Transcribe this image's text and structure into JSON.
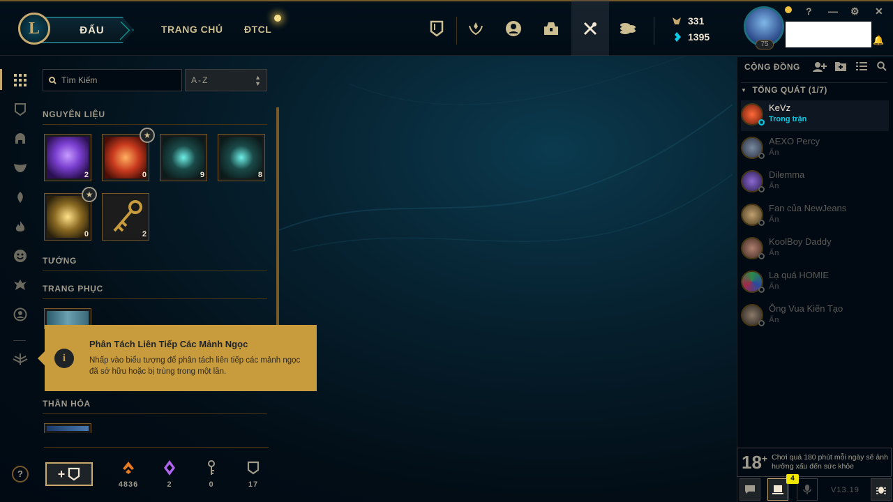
{
  "topbar": {
    "play_label": "ĐẤU",
    "nav": [
      "TRANG CHỦ",
      "ĐTCL"
    ],
    "blue_essence": "331",
    "riot_points": "1395",
    "level": "75",
    "window_controls": [
      "?",
      "—",
      "⚙",
      "✕"
    ]
  },
  "icons": {
    "topbar": [
      "collection-icon",
      "ranked-icon",
      "profile-icon",
      "loot-icon",
      "crafting-icon",
      "store-icon"
    ],
    "leftnav": [
      "all-icon",
      "chest-icon",
      "helmet-icon",
      "mask-icon",
      "ward-icon",
      "flame-icon",
      "emote-icon",
      "totem-icon",
      "icon-icon",
      "crest-icon"
    ]
  },
  "loot": {
    "search_placeholder": "Tìm Kiếm",
    "sort_value": "A-Z",
    "sections": {
      "materials": "NGUYÊN LIỆU",
      "champions": "TƯỚNG",
      "skins": "TRANG PHỤC",
      "summon": "THẦN HỎA"
    },
    "materials": [
      {
        "count": "2",
        "color": "#7a3fd0"
      },
      {
        "count": "0",
        "color": "#c83a1e"
      },
      {
        "count": "9",
        "color": "#2b8f8c"
      },
      {
        "count": "8",
        "color": "#2b8f8c"
      },
      {
        "count": "0",
        "color": "#c8aa6e"
      },
      {
        "count": "2",
        "color": "#c89b3c"
      }
    ]
  },
  "tooltip": {
    "title": "Phân Tách Liên Tiếp Các Mảnh Ngọc",
    "body": "Nhấp vào biểu tượng để phân tách liên tiếp các mảnh ngọc đã sở hữu hoặc bị trùng trong một lần.",
    "icon": "i"
  },
  "resources": [
    {
      "name": "orange-essence-icon",
      "value": "4836"
    },
    {
      "name": "mythic-essence-icon",
      "value": "2"
    },
    {
      "name": "key-fragment-icon",
      "value": "0"
    },
    {
      "name": "chest-count-icon",
      "value": "17"
    }
  ],
  "social": {
    "header": "CỘNG ĐỒNG",
    "group": "TỔNG QUÁT (1/7)",
    "friends": [
      {
        "name": "KeVz",
        "status": "Trong trận"
      },
      {
        "name": "AEXO Percy",
        "status": "Ẩn"
      },
      {
        "name": "Dilemma",
        "status": "Ẩn"
      },
      {
        "name": "Fan của NewJeans",
        "status": "Ẩn"
      },
      {
        "name": "KoolBoy Daddy",
        "status": "Ẩn"
      },
      {
        "name": "Lạ quá HOMIE",
        "status": "Ẩn"
      },
      {
        "name": "Ông Vua Kiến Tạo",
        "status": "Ẩn"
      }
    ]
  },
  "footer": {
    "age_rating": "18",
    "age_plus": "+",
    "warning": "Chơi quá 180 phút mỗi ngày sẽ ảnh hưởng xấu đến sức khỏe",
    "mission_badge": "4",
    "version": "V13.19"
  }
}
